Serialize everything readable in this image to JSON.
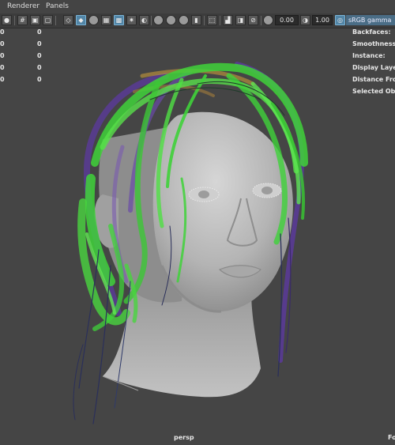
{
  "menu": {
    "renderer": "Renderer",
    "panels": "Panels"
  },
  "toolbar": {
    "exposure_value": "0.00",
    "gamma_value": "1.00",
    "color_space": "sRGB gamma"
  },
  "hud_left": [
    {
      "a": "0",
      "b": "0"
    },
    {
      "a": "0",
      "b": "0"
    },
    {
      "a": "0",
      "b": "0"
    },
    {
      "a": "0",
      "b": "0"
    },
    {
      "a": "0",
      "b": "0"
    }
  ],
  "hud_right": {
    "backfaces": "Backfaces:",
    "smoothness": "Smoothness:",
    "instance": "Instance:",
    "display_layer": "Display Layer:",
    "distance_from": "Distance From",
    "selected_objects": "Selected Obje"
  },
  "viewport": {
    "camera": "persp",
    "right_edge_label": "Fo"
  },
  "colors": {
    "viewport_bg": "#454545",
    "hair_green": "#3fd23a",
    "hair_purple": "#5a3a9a",
    "skin": "#b8b8b8"
  },
  "icons": [
    "select-icon",
    "grid-icon",
    "camera-icon",
    "bookmark-icon",
    "texture-icon",
    "wireframe-cube-icon",
    "shaded-cube-icon",
    "lighting-icon",
    "shadow-icon",
    "xray-icon",
    "isolate-icon",
    "light-icon",
    "hud-icon",
    "sphere-icon",
    "motion-blur-icon",
    "aa-icon",
    "dof-icon",
    "display-icon",
    "exposure-icon",
    "gamma-icon"
  ]
}
